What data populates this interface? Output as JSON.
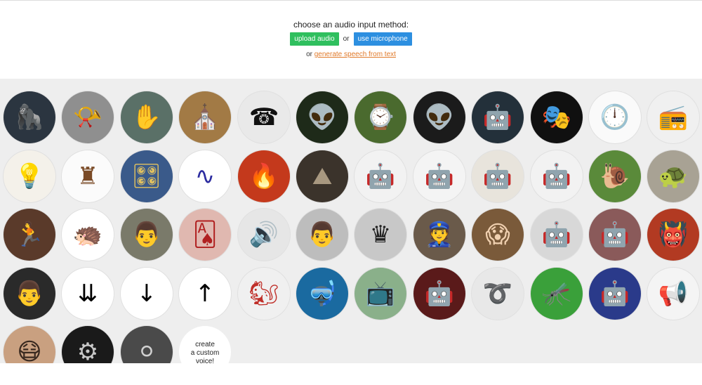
{
  "header": {
    "prompt": "choose an audio input method:",
    "upload_label": "upload audio",
    "or_label": "or",
    "mic_label": "use microphone",
    "tts_prefix": "or",
    "tts_link": "generate speech from text"
  },
  "colors": {
    "upload_button": "#2fbf5e",
    "mic_button": "#2d8fe0",
    "link": "#e07a2a",
    "gallery_bg": "#eeeeee"
  },
  "voices": [
    {
      "icon": "gorilla-roar-icon",
      "glyph": "🦍",
      "bg": "#2b3540",
      "fg": "#d7dde3"
    },
    {
      "icon": "gramophone-icon",
      "glyph": "📯",
      "bg": "#8f8f8f",
      "fg": "#1e1e1e"
    },
    {
      "icon": "ghost-silhouette-icon",
      "glyph": "✋",
      "bg": "#5a7067",
      "fg": "#cfdad4"
    },
    {
      "icon": "cathedral-interior-icon",
      "glyph": "⛪",
      "bg": "#a27a45",
      "fg": "#f3e2bd"
    },
    {
      "icon": "rotary-telephone-icon",
      "glyph": "☎",
      "bg": "#e9e9e9",
      "fg": "#111111"
    },
    {
      "icon": "alien-face-icon",
      "glyph": "👽",
      "bg": "#1e2a19",
      "fg": "#b8c4a6"
    },
    {
      "icon": "melting-clock-icon",
      "glyph": "⌚",
      "bg": "#4a6a2e",
      "fg": "#e8c08a"
    },
    {
      "icon": "grey-alien-icon",
      "glyph": "👽",
      "bg": "#1b1b1b",
      "fg": "#8a8a8a"
    },
    {
      "icon": "robot-mask-icon",
      "glyph": "🤖",
      "bg": "#23303a",
      "fg": "#b46a4a"
    },
    {
      "icon": "guy-fawkes-mask-icon",
      "glyph": "🎭",
      "bg": "#101010",
      "fg": "#f2f2f2"
    },
    {
      "icon": "wall-clock-icon",
      "glyph": "🕛",
      "bg": "#fafafa",
      "fg": "#111111"
    },
    {
      "icon": "vintage-radio-icon",
      "glyph": "📻",
      "bg": "#f0f0f0",
      "fg": "#5a4a3a"
    },
    {
      "icon": "desk-lamp-icon",
      "glyph": "💡",
      "bg": "#f4f1ea",
      "fg": "#a0784a"
    },
    {
      "icon": "dalek-icon",
      "glyph": "♜",
      "bg": "#fbfbfb",
      "fg": "#7a4a26"
    },
    {
      "icon": "synthesizer-pedal-icon",
      "glyph": "🎛",
      "bg": "#3a5a8a",
      "fg": "#e0c060"
    },
    {
      "icon": "sine-wave-icon",
      "glyph": "∿",
      "bg": "#ffffff",
      "fg": "#2c2ca0"
    },
    {
      "icon": "fire-demon-icon",
      "glyph": "🔥",
      "bg": "#c4391c",
      "fg": "#ffd24a"
    },
    {
      "icon": "cave-icon",
      "glyph": "⛰",
      "bg": "#3b332b",
      "fg": "#a89880"
    },
    {
      "icon": "robot-walker-icon",
      "glyph": "🤖",
      "bg": "#f2f2f2",
      "fg": "#555555"
    },
    {
      "icon": "white-robot-icon",
      "glyph": "🤖",
      "bg": "#f4f4f4",
      "fg": "#777777"
    },
    {
      "icon": "toy-robot-icon",
      "glyph": "🤖",
      "bg": "#e8e4dc",
      "fg": "#3a3a3a"
    },
    {
      "icon": "lego-robot-icon",
      "glyph": "🤖",
      "bg": "#f2f2f2",
      "fg": "#c23a3a"
    },
    {
      "icon": "snail-icon",
      "glyph": "🐌",
      "bg": "#5a8a3a",
      "fg": "#e0c8a0"
    },
    {
      "icon": "tortoise-icon",
      "glyph": "🐢",
      "bg": "#a8a294",
      "fg": "#4a4030"
    },
    {
      "icon": "sprinter-icon",
      "glyph": "🏃",
      "bg": "#5a3a2a",
      "fg": "#e0e0e0"
    },
    {
      "icon": "sonic-hedgehog-icon",
      "glyph": "🦔",
      "bg": "#ffffff",
      "fg": "#1f56c9"
    },
    {
      "icon": "general-portrait-icon",
      "glyph": "👨",
      "bg": "#7a7a6a",
      "fg": "#2a2a2a"
    },
    {
      "icon": "playing-cards-icon",
      "glyph": "🂡",
      "bg": "#e0b8b0",
      "fg": "#b02020"
    },
    {
      "icon": "wooden-speaker-icon",
      "glyph": "🔊",
      "bg": "#e6e6e6",
      "fg": "#7a4a22"
    },
    {
      "icon": "phonograph-inventor-icon",
      "glyph": "👨",
      "bg": "#bdbdbd",
      "fg": "#2a2a2a"
    },
    {
      "icon": "dark-lord-icon",
      "glyph": "♛",
      "bg": "#c8c8c8",
      "fg": "#222222"
    },
    {
      "icon": "soldier-portrait-icon",
      "glyph": "👮",
      "bg": "#6a5a4a",
      "fg": "#e0c0a0"
    },
    {
      "icon": "wtf-meme-icon",
      "glyph": "😱",
      "bg": "#7a5a3a",
      "fg": "#f0d0b0"
    },
    {
      "icon": "gir-robot-icon",
      "glyph": "🤖",
      "bg": "#d8d8d8",
      "fg": "#6a6a6a"
    },
    {
      "icon": "kirobo-robot-icon",
      "glyph": "🤖",
      "bg": "#8a5a5a",
      "fg": "#f0f0f0"
    },
    {
      "icon": "red-demon-icon",
      "glyph": "👹",
      "bg": "#b23a22",
      "fg": "#f0b080"
    },
    {
      "icon": "astronaut-icon",
      "glyph": "👨",
      "bg": "#2a2a2a",
      "fg": "#e0e0e0"
    },
    {
      "icon": "arrows-down-icon",
      "glyph": "⇊",
      "bg": "#ffffff",
      "fg": "#000000"
    },
    {
      "icon": "arrows-down-dense-icon",
      "glyph": "↓",
      "bg": "#ffffff",
      "fg": "#000000"
    },
    {
      "icon": "arrows-up-dense-icon",
      "glyph": "↑",
      "bg": "#ffffff",
      "fg": "#000000"
    },
    {
      "icon": "chipmunk-icon",
      "glyph": "🐿",
      "bg": "#f0f0f0",
      "fg": "#c0302a"
    },
    {
      "icon": "scuba-diver-icon",
      "glyph": "🤿",
      "bg": "#1a6aa0",
      "fg": "#e0f0ff"
    },
    {
      "icon": "tv-robot-face-icon",
      "glyph": "📺",
      "bg": "#8ab08a",
      "fg": "#e8e8e8"
    },
    {
      "icon": "red-mech-icon",
      "glyph": "🤖",
      "bg": "#5a1a1a",
      "fg": "#c04040"
    },
    {
      "icon": "coiled-cable-icon",
      "glyph": "➰",
      "bg": "#e8e8e8",
      "fg": "#222222"
    },
    {
      "icon": "mosquito-icon",
      "glyph": "🦟",
      "bg": "#3aa03a",
      "fg": "#1a3a1a"
    },
    {
      "icon": "blue-robot-icon",
      "glyph": "🤖",
      "bg": "#2a3a8a",
      "fg": "#c0d0f0"
    },
    {
      "icon": "megaphone-icon",
      "glyph": "📢",
      "bg": "#f4f4f4",
      "fg": "#2a6ac0"
    },
    {
      "icon": "bane-mask-icon",
      "glyph": "😷",
      "bg": "#c9a080",
      "fg": "#3a2a20"
    },
    {
      "icon": "handlebar-icon",
      "glyph": "⚙",
      "bg": "#1a1a1a",
      "fg": "#c8c8c8"
    },
    {
      "icon": "metal-knob-icon",
      "glyph": "⚪",
      "bg": "#4a4a4a",
      "fg": "#d0d0d0"
    }
  ],
  "custom_voice": {
    "line1": "create",
    "line2": "a custom",
    "line3": "voice!"
  }
}
